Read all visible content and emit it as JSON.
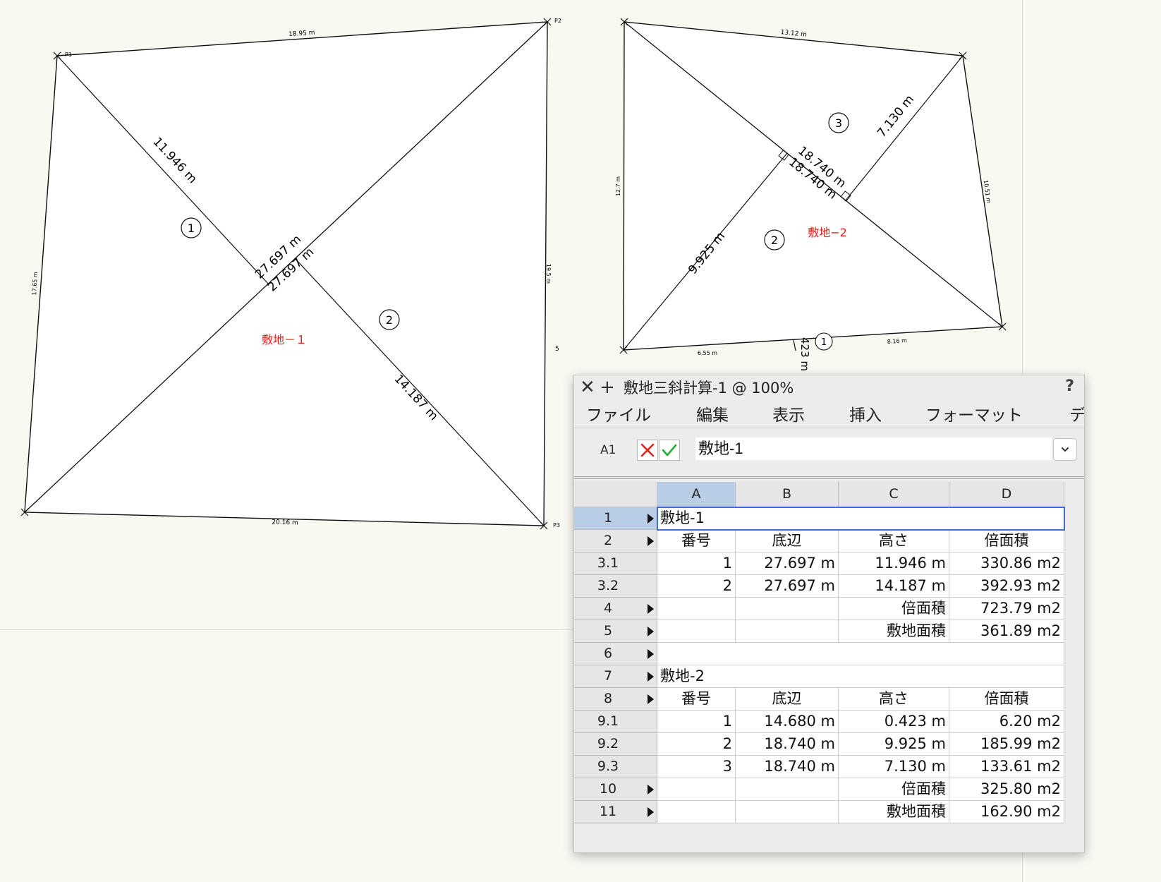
{
  "colors": {
    "accent": "#3d6fd1",
    "site_label": "#e0231a",
    "canvas_bg": "#f9f8f1",
    "selected_header": "#b9cde6"
  },
  "drawing": {
    "site1": {
      "name": "敷地－１",
      "points": [
        "P1",
        "P2",
        "P3"
      ],
      "edges": [
        "18.95 m",
        "19.5 m",
        "20.16 m",
        "17.65 m"
      ],
      "side_label": "5",
      "diagonal": "27.697 m",
      "diagonal_b": "27.697 m",
      "heights": [
        "11.946 m",
        "14.187 m"
      ],
      "triangles": [
        "1",
        "2"
      ]
    },
    "site2": {
      "name": "敷地−2",
      "edges": [
        "13.12 m",
        "10.51 m",
        "8.16 m",
        "6.55 m",
        "12.7 m"
      ],
      "base": "18.740 m",
      "base_b": "18.740 m",
      "heights": [
        "9.925 m",
        "7.130 m",
        "423 m"
      ],
      "triangles": [
        "1",
        "2",
        "3"
      ]
    }
  },
  "worksheet": {
    "title": "敷地三斜計算-1 @ 100%",
    "help": "?",
    "menu": [
      "ファイル",
      "編集",
      "表示",
      "挿入",
      "フォーマット",
      "デ"
    ],
    "cell_ref": "A1",
    "formula_value": "敷地-1",
    "columns": [
      "A",
      "B",
      "C",
      "D"
    ],
    "rows": [
      {
        "id": "1",
        "arrow": true,
        "merged": "敷地-1"
      },
      {
        "id": "2",
        "arrow": true,
        "cells": [
          "番号",
          "底辺",
          "高さ",
          "倍面積"
        ],
        "header": true
      },
      {
        "id": "3.1",
        "arrow": false,
        "cells": [
          "1",
          "27.697 m",
          "11.946 m",
          "330.86 m2"
        ]
      },
      {
        "id": "3.2",
        "arrow": false,
        "cells": [
          "2",
          "27.697 m",
          "14.187 m",
          "392.93 m2"
        ]
      },
      {
        "id": "4",
        "arrow": true,
        "cells": [
          "",
          "",
          "倍面積",
          "723.79 m2"
        ]
      },
      {
        "id": "5",
        "arrow": true,
        "cells": [
          "",
          "",
          "敷地面積",
          "361.89 m2"
        ]
      },
      {
        "id": "6",
        "arrow": true,
        "merged": ""
      },
      {
        "id": "7",
        "arrow": true,
        "merged": "敷地-2"
      },
      {
        "id": "8",
        "arrow": true,
        "cells": [
          "番号",
          "底辺",
          "高さ",
          "倍面積"
        ],
        "header": true
      },
      {
        "id": "9.1",
        "arrow": false,
        "cells": [
          "1",
          "14.680 m",
          "0.423 m",
          "6.20 m2"
        ]
      },
      {
        "id": "9.2",
        "arrow": false,
        "cells": [
          "2",
          "18.740 m",
          "9.925 m",
          "185.99 m2"
        ]
      },
      {
        "id": "9.3",
        "arrow": false,
        "cells": [
          "3",
          "18.740 m",
          "7.130 m",
          "133.61 m2"
        ]
      },
      {
        "id": "10",
        "arrow": true,
        "cells": [
          "",
          "",
          "倍面積",
          "325.80 m2"
        ]
      },
      {
        "id": "11",
        "arrow": true,
        "cells": [
          "",
          "",
          "敷地面積",
          "162.90 m2"
        ]
      }
    ]
  }
}
